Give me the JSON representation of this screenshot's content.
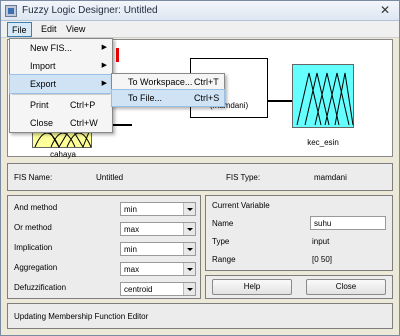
{
  "window": {
    "title": "Fuzzy Logic Designer: Untitled",
    "close_glyph": "✕"
  },
  "menubar": {
    "file": "File",
    "edit": "Edit",
    "view": "View"
  },
  "file_menu": {
    "items": [
      {
        "label": "New FIS...",
        "has_submenu": true
      },
      {
        "label": "Import",
        "has_submenu": true
      },
      {
        "label": "Export",
        "has_submenu": true
      },
      {
        "label": "Print",
        "shortcut": "Ctrl+P"
      },
      {
        "label": "Close",
        "shortcut": "Ctrl+W"
      }
    ],
    "arrow": "▶"
  },
  "export_submenu": {
    "items": [
      {
        "label": "To Workspace...",
        "shortcut": "Ctrl+T"
      },
      {
        "label": "To File...",
        "shortcut": "Ctrl+S"
      }
    ]
  },
  "diagram": {
    "input_label": "cahaya",
    "rule_label": "(mamdani)",
    "output_label": "kec_esin",
    "colors": {
      "input": "#ffff99",
      "output": "#66ffff",
      "marker": "#ee0000"
    }
  },
  "fis_info": {
    "name_label": "FIS Name:",
    "name_value": "Untitled",
    "type_label": "FIS Type:",
    "type_value": "mamdani"
  },
  "methods": {
    "and": {
      "label": "And method",
      "value": "min"
    },
    "or": {
      "label": "Or method",
      "value": "max"
    },
    "implication": {
      "label": "Implication",
      "value": "min"
    },
    "aggregation": {
      "label": "Aggregation",
      "value": "max"
    },
    "defuzz": {
      "label": "Defuzzification",
      "value": "centroid"
    }
  },
  "current_variable": {
    "heading": "Current Variable",
    "name_label": "Name",
    "name_value": "suhu",
    "type_label": "Type",
    "type_value": "input",
    "range_label": "Range",
    "range_value": "[0 50]"
  },
  "buttons": {
    "help": "Help",
    "close": "Close"
  },
  "status": {
    "text": "Updating Membership Function Editor"
  }
}
